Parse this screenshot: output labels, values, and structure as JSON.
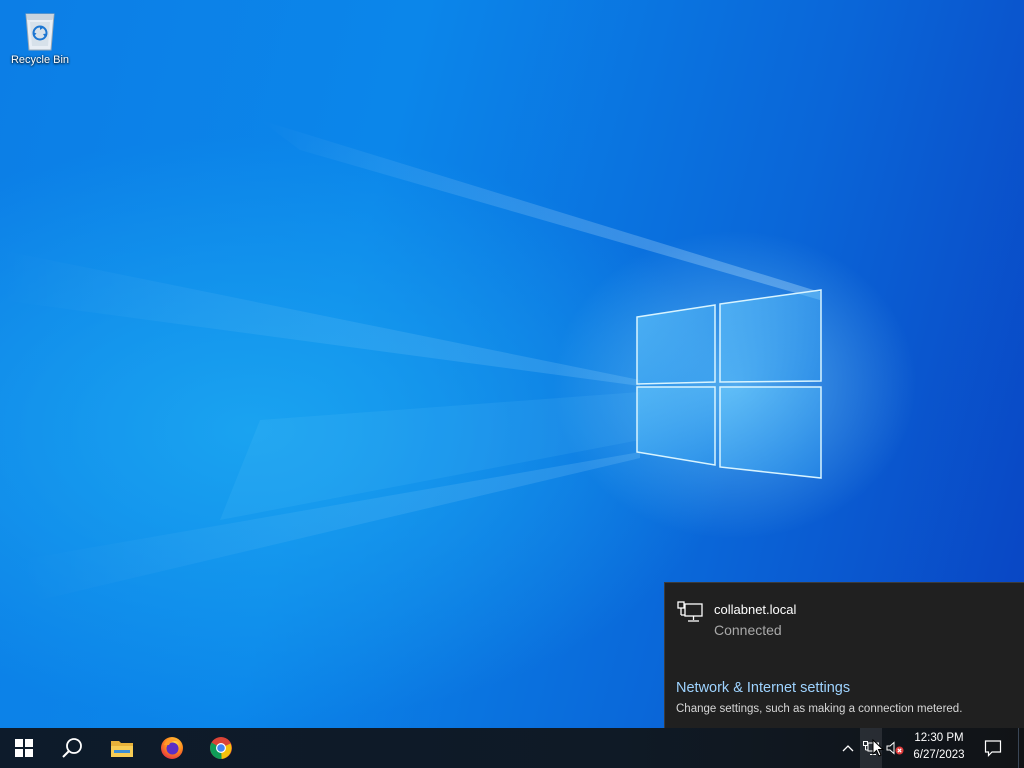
{
  "desktop": {
    "icons": [
      {
        "label": "Recycle Bin",
        "icon": "recycle-bin-icon"
      }
    ]
  },
  "network_flyout": {
    "network": {
      "name": "collabnet.local",
      "status": "Connected",
      "icon": "ethernet-network-icon"
    },
    "settings_link": "Network & Internet settings",
    "settings_description": "Change settings, such as making a connection metered."
  },
  "taskbar": {
    "pinned": [
      {
        "name": "Start",
        "icon": "windows-start-icon"
      },
      {
        "name": "Search",
        "icon": "search-icon"
      },
      {
        "name": "File Explorer",
        "icon": "file-explorer-icon"
      },
      {
        "name": "Firefox",
        "icon": "firefox-icon"
      },
      {
        "name": "Google Chrome",
        "icon": "chrome-icon"
      }
    ],
    "tray": {
      "overflow_icon": "chevron-up-icon",
      "network_icon": "ethernet-network-icon",
      "volume_icon": "speaker-muted-icon",
      "time": "12:30 PM",
      "date": "6/27/2023",
      "notifications_icon": "action-center-icon"
    }
  },
  "colors": {
    "taskbar": "#0f1a26",
    "flyout_background": "#202020",
    "link": "#9ed3ff",
    "wallpaper": "#0a6ad8"
  }
}
